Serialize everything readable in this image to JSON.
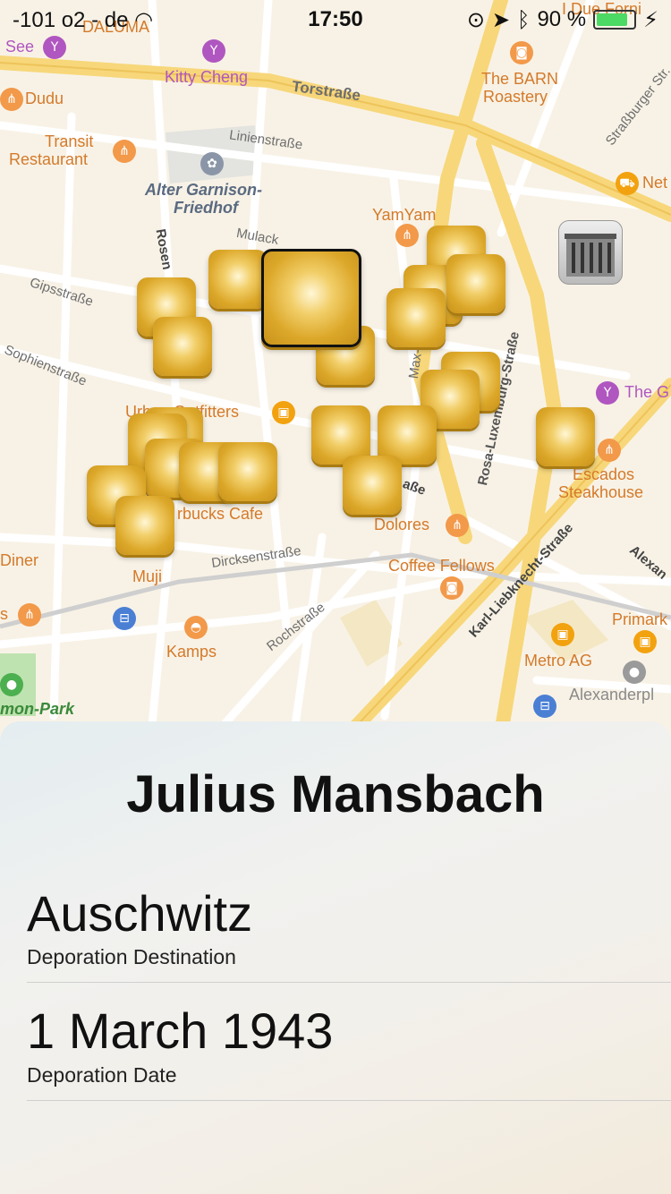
{
  "status_bar": {
    "carrier": "-101 o2 - de",
    "time": "17:50",
    "battery_percent": "90 %",
    "battery_level": 0.9
  },
  "map": {
    "labels": {
      "see": "See",
      "daluma": "DALUMA",
      "i_due_forni": "I Due Forni",
      "kitty_cheng": "Kitty Cheng",
      "torstrasse": "Torstraße",
      "the_barn": "The BARN",
      "roastery": "Roastery",
      "dudu": "Dudu",
      "strassburger": "Straßburger Str.",
      "transit": "Transit",
      "restaurant": "Restaurant",
      "linienstrasse": "Linienstraße",
      "alter_garnison": "Alter Garnison-",
      "friedhof": "Friedhof",
      "netto": "Net",
      "yamyam": "YamYam",
      "rosen": "Rosen",
      "mulack": "Mulack",
      "gipsstrasse": "Gipsstraße",
      "sophienstrasse": "Sophienstraße",
      "max": "Max-",
      "rosa_luxemburg": "Rosa-Luxemburg-Straße",
      "the_g": "The G",
      "urban_outfitters": "Urban Outfitters",
      "starbucks": "rbucks Cafe",
      "escados": "Escados",
      "steakhouse": "Steakhouse",
      "strasse_frag": "aße",
      "dolores": "Dolores",
      "diner": "Diner",
      "muji": "Muji",
      "dircksen": "Dircksenstraße",
      "coffee_fellows": "Coffee Fellows",
      "karl_liebknecht": "Karl-Liebknecht-Straße",
      "alexander_str": "Alexan",
      "primark": "Primark",
      "kamps": "Kamps",
      "rochstrasse": "Rochstraße",
      "metro_ag": "Metro AG",
      "alexanderplatz": "Alexanderpl",
      "park": "mon-Park",
      "s_frag": "s"
    }
  },
  "sheet": {
    "title": "Julius Mansbach",
    "fields": [
      {
        "value": "Auschwitz",
        "label": "Deporation Destination"
      },
      {
        "value": "1 March 1943",
        "label": "Deporation Date"
      }
    ]
  },
  "colors": {
    "map_background": "#f8f2e6",
    "marker_gold": "#dca82a",
    "major_road": "#f7d77a",
    "poi_orange": "#d47a2a",
    "poi_purple": "#b056c0"
  }
}
